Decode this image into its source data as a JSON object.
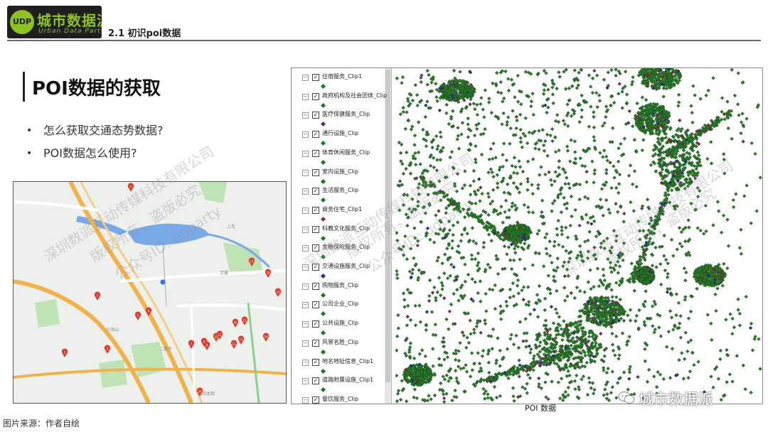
{
  "header": {
    "logo_title": "城市数据派",
    "logo_subtitle": "Urban Data Party",
    "logo_badge": "UDP",
    "section_title": "2.1 初识poi数据"
  },
  "slide": {
    "title": "POI数据的获取",
    "bullet_symbol": "•",
    "bullets": [
      "怎么获取交通态势数据?",
      "POI数据怎么使用?"
    ]
  },
  "map_labels": {
    "road_1": "京藏",
    "road_2": "上东",
    "road_3": "二拨子",
    "road_4": "小汤山",
    "road_5": "回龙观"
  },
  "map_markers": [
    "1",
    "2",
    "3",
    "4",
    "5",
    "6",
    "7",
    "8",
    "9",
    "10",
    "11",
    "12",
    "13",
    "14",
    "15",
    "16",
    "17",
    "18",
    "19",
    "20"
  ],
  "gis": {
    "layers": [
      {
        "name": "住宿服务_Clip1",
        "color": "#1a7a2a"
      },
      {
        "name": "政府机构及社会团体_Clip",
        "color": "#1a7a2a"
      },
      {
        "name": "医疗保健服务_Clip",
        "color": "#5b2a8a"
      },
      {
        "name": "通行设施_Clip",
        "color": "#1a7a2a"
      },
      {
        "name": "体育休闲服务_Clip",
        "color": "#1a7a2a"
      },
      {
        "name": "室内设施_Clip",
        "color": "#1a7a2a"
      },
      {
        "name": "生活服务_Clip",
        "color": "#1a7a2a"
      },
      {
        "name": "商务住宅_Clip1",
        "color": "#8a2a5a"
      },
      {
        "name": "科教文化服务_Clip",
        "color": "#1a7a2a"
      },
      {
        "name": "金融保险服务_Clip",
        "color": "#1a7a2a"
      },
      {
        "name": "交通设施服务_Clip",
        "color": "#2a3a8a"
      },
      {
        "name": "购物服务_Clip",
        "color": "#1a7a2a"
      },
      {
        "name": "公司企业_Clip",
        "color": "#1a7a2a"
      },
      {
        "name": "公共设施_Clip",
        "color": "#1a7a2a"
      },
      {
        "name": "风景名胜_Clip",
        "color": "#1a7a2a"
      },
      {
        "name": "地名地址信息_Clip1",
        "color": "#1a7a2a"
      },
      {
        "name": "道路附属设施_Clip1",
        "color": "#1a7a2a"
      },
      {
        "name": "餐饮服务_Clip",
        "color": "#1a7a2a"
      }
    ],
    "caption": "POI 数据",
    "point_color": "#2a7d2a",
    "point_outline": "#123a12",
    "accent_colors": [
      "#8a2a8a",
      "#2a2a9a",
      "#8a2a2a"
    ]
  },
  "watermark": {
    "company": "深圳数派互动传媒科技有限公司",
    "rights": "版权所有，盗版必究",
    "account": "公众号ID: udparty"
  },
  "wechat_label": "城市数据派",
  "footnote": "图片来源：作者自绘",
  "colors": {
    "brand_green": "#8dc21f",
    "logo_bg": "#1f1f1f",
    "marker_red": "#e03a2a",
    "map_water": "#7aa9e8",
    "map_road_orange": "#f2b24a",
    "map_green": "#bfe3b4"
  }
}
